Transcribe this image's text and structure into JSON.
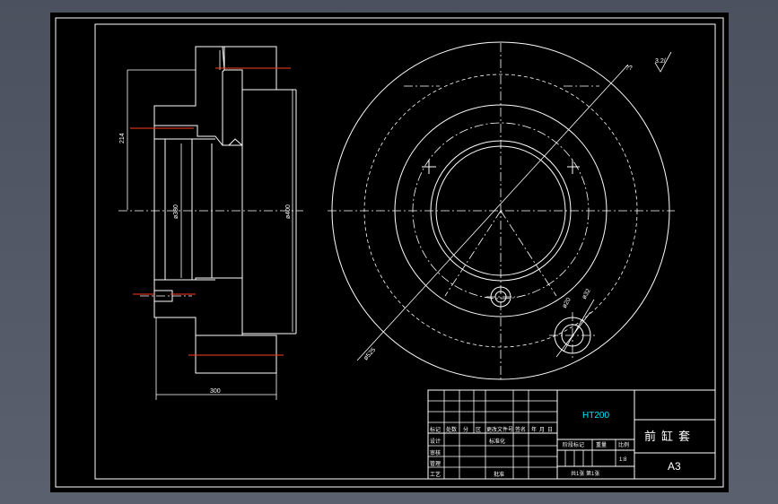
{
  "drawing": {
    "dimensions": {
      "height_214": "214",
      "dia_380": "ø380",
      "dia_400": "ø400",
      "width_300": "300",
      "dia_525": "ø525",
      "dia_20": "ø20",
      "dia_32": "ø32",
      "surface_note": "??",
      "roughness": "3.2/"
    },
    "title_block": {
      "material": "HT200",
      "part_name": "前缸套",
      "sheet_size": "A3",
      "scale": "1:8",
      "sheet_count": "共1张 第1张",
      "row_headers": [
        "标记",
        "处数",
        "分",
        "区",
        "更改文件号",
        "签名",
        "年",
        "月",
        "日"
      ],
      "roles": [
        "设计",
        "审核",
        "工艺"
      ],
      "standardization": "标准化",
      "approve": "批准",
      "stage_mark": "阶段标记",
      "weight": "重量",
      "ratio": "比例",
      "manage": "管理"
    }
  },
  "colors": {
    "background": "#000000",
    "frame": "#ffffff",
    "red_accent": "#ff3b1f",
    "material_text": "#00e5ff"
  }
}
